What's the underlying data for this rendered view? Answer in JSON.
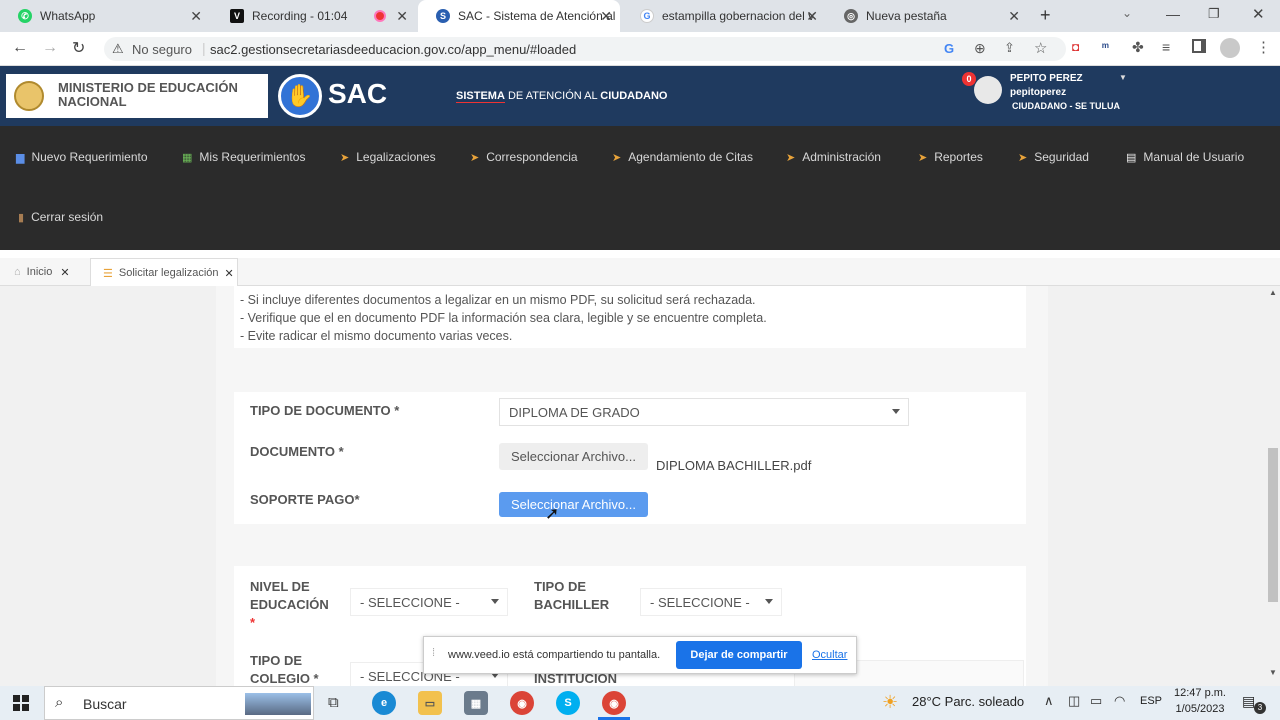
{
  "browser": {
    "tabs": [
      {
        "label": "WhatsApp",
        "icon": "whatsapp-icon"
      },
      {
        "label": "Recording - 01:04",
        "icon": "veed-icon"
      },
      {
        "label": "SAC - Sistema de Atención al",
        "icon": "sac-icon"
      },
      {
        "label": "estampilla gobernacion del v",
        "icon": "google-icon"
      },
      {
        "label": "Nueva pestaña",
        "icon": "chrome-icon"
      }
    ],
    "security_label": "No seguro",
    "url": "sac2.gestionsecretariasdeeducacion.gov.co/app_menu/#loaded"
  },
  "header": {
    "ministry": "MINISTERIO DE EDUCACIÓN NACIONAL",
    "logo_text": "SAC",
    "subtitle_prefix": "SISTEMA",
    "subtitle_mid": " DE ATENCIÓN AL ",
    "subtitle_suffix": "CIUDADANO",
    "notification_count": "0",
    "user_name": "PEPITO PEREZ",
    "user_login": "pepitoperez",
    "user_role": "CIUDADANO - SE TULUA"
  },
  "nav": {
    "items": [
      {
        "label": "Nuevo Requerimiento",
        "icon": "document-icon"
      },
      {
        "label": "Mis Requerimientos",
        "icon": "table-icon"
      },
      {
        "label": "Legalizaciones",
        "icon": "chevron-icon"
      },
      {
        "label": "Correspondencia",
        "icon": "chevron-icon"
      },
      {
        "label": "Agendamiento de Citas",
        "icon": "chevron-icon"
      },
      {
        "label": "Administración",
        "icon": "chevron-icon"
      },
      {
        "label": "Reportes",
        "icon": "chevron-icon"
      },
      {
        "label": "Seguridad",
        "icon": "chevron-icon"
      },
      {
        "label": "Manual de Usuario",
        "icon": "manual-icon"
      },
      {
        "label": "Cerrar sesión",
        "icon": "exit-icon"
      }
    ]
  },
  "breadcrumb_tabs": [
    {
      "label": "Inicio",
      "icon": "home-icon"
    },
    {
      "label": "Solicitar legalización",
      "icon": "list-icon"
    }
  ],
  "notes": [
    "- Si incluye diferentes documentos a legalizar en un mismo PDF, su solicitud será rechazada.",
    "- Verifique que el en documento PDF la información sea clara, legible y se encuentre completa.",
    "- Evite radicar el mismo documento varias veces."
  ],
  "form": {
    "doc_type_label": "TIPO DE DOCUMENTO *",
    "doc_type_value": "DIPLOMA DE GRADO",
    "document_label": "DOCUMENTO *",
    "file_button": "Seleccionar Archivo...",
    "document_file": "DIPLOMA BACHILLER.pdf",
    "payment_label": "SOPORTE PAGO*",
    "payment_button": "Seleccionar Archivo...",
    "education_level_label_1": "NIVEL DE",
    "education_level_label_2": "EDUCACIÓN",
    "education_level_label_3": "*",
    "education_level_value": "- SELECCIONE -",
    "bachiller_label_1": "TIPO DE",
    "bachiller_label_2": "BACHILLER",
    "bachiller_value": "- SELECCIONE -",
    "school_label_1": "TIPO DE",
    "school_label_2": "COLEGIO *",
    "school_value": "- SELECCIONE -",
    "institution_label": "INSTITUCIÓN"
  },
  "share_bar": {
    "message": "www.veed.io está compartiendo tu pantalla.",
    "stop_button": "Dejar de compartir",
    "hide_link": "Ocultar"
  },
  "taskbar": {
    "search_label": "Buscar",
    "weather": "28°C  Parc. soleado",
    "language": "ESP",
    "time": "12:47 p.m.",
    "date": "1/05/2023",
    "notification_count": "3"
  },
  "colors": {
    "header_bg": "#1f3a5f",
    "nav_bg": "#2b2b2b",
    "primary_button": "#5b9bef",
    "share_button": "#1a73e8"
  }
}
